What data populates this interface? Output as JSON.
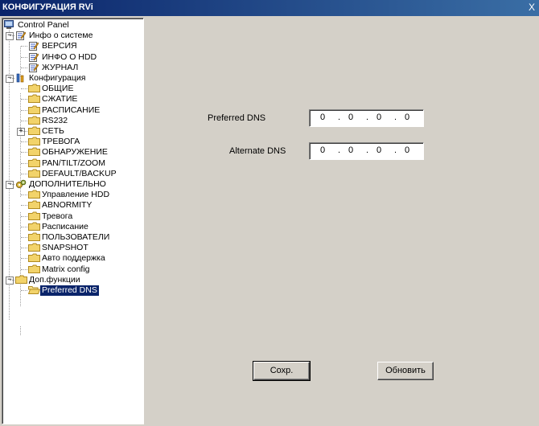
{
  "window": {
    "title": "КОНФИГУРАЦИЯ RVi",
    "close_label": "X"
  },
  "tree": {
    "root": "Control Panel",
    "groups": [
      {
        "label": "Инфо о системе",
        "icon": "notepad-icon",
        "items": [
          "ВЕРСИЯ",
          "ИНФО О HDD",
          "ЖУРНАЛ"
        ]
      },
      {
        "label": "Конфигурация",
        "icon": "tools-icon",
        "items": [
          "ОБЩИЕ",
          "СЖАТИЕ",
          "РАСПИСАНИЕ",
          "RS232",
          "СЕТЬ",
          "ТРЕВОГА",
          "ОБНАРУЖЕНИЕ",
          "PAN/TILT/ZOOM",
          "DEFAULT/BACKUP"
        ]
      },
      {
        "label": "ДОПОЛНИТЕЛЬНО",
        "icon": "gears-icon",
        "items": [
          "Управление HDD",
          "ABNORMITY",
          "Тревога",
          "Расписание",
          "ПОЛЬЗОВАТЕЛИ",
          "SNAPSHOT",
          "Авто поддержка",
          "Matrix config"
        ]
      },
      {
        "label": "Доп.функции",
        "icon": "folder-icon",
        "items": [
          "Preferred DNS"
        ]
      }
    ],
    "selected": "Preferred DNS"
  },
  "form": {
    "preferred_label": "Preferred DNS",
    "preferred": [
      "0",
      "0",
      "0",
      "0"
    ],
    "alternate_label": "Alternate DNS",
    "alternate": [
      "0",
      "0",
      "0",
      "0"
    ],
    "dot": "."
  },
  "buttons": {
    "save": "Сохр.",
    "refresh": "Обновить"
  },
  "colors": {
    "titlebar": "#0a246a",
    "panel": "#d4d0c8",
    "selection": "#0a246a",
    "folder": "#f2d36a"
  }
}
